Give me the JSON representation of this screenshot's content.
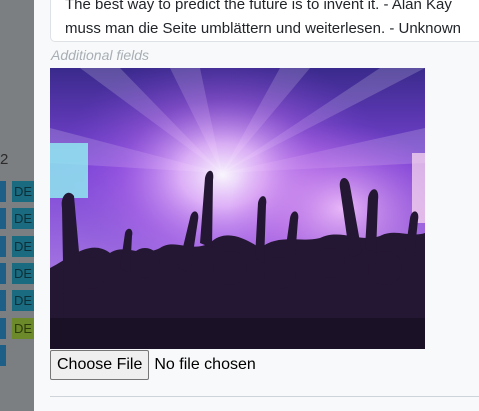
{
  "background": {
    "column_label": "2",
    "badges": [
      "DE",
      "DE",
      "DE",
      "DE",
      "DE",
      "DE",
      "DE"
    ]
  },
  "modal": {
    "quote_lines": [
      "The best way to predict the future is to invent it. - Alan Kay",
      "muss man die Seite umblättern und weiterlesen. - Unknown"
    ],
    "section_label": "Additional fields",
    "image": {
      "subject": "concert crowd silhouettes under purple stage lights"
    },
    "file_input": {
      "button_label": "Choose File",
      "status": "No file chosen"
    }
  },
  "colors": {
    "panel_bg": "#f8f9fa",
    "label_gray": "#a8aeb4",
    "badge_blue": "#1a6b80",
    "badge_green": "#6c8a2a",
    "stage_purple": "#7a3fd0"
  }
}
